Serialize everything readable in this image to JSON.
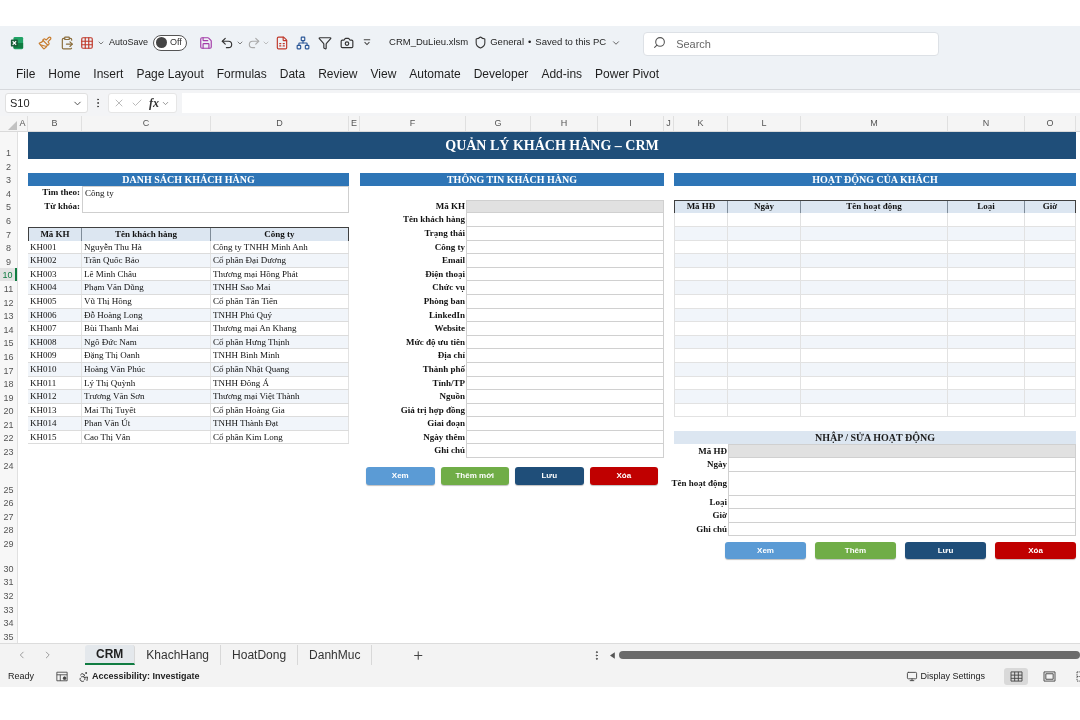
{
  "title_bar": {
    "autosave": {
      "label": "AutoSave",
      "toggle": "Off",
      "on": false
    },
    "file_name": "CRM_DuLieu.xlsm",
    "sensitivity": "General",
    "separator": "•",
    "save_status": "Saved to this PC",
    "search": {
      "placeholder": "Search"
    }
  },
  "ribbon_tabs": [
    {
      "label": "File",
      "selected": false
    },
    {
      "label": "Home",
      "selected": false
    },
    {
      "label": "Insert",
      "selected": false
    },
    {
      "label": "Page Layout",
      "selected": false
    },
    {
      "label": "Formulas",
      "selected": false
    },
    {
      "label": "Data",
      "selected": false
    },
    {
      "label": "Review",
      "selected": false
    },
    {
      "label": "View",
      "selected": false
    },
    {
      "label": "Automate",
      "selected": false
    },
    {
      "label": "Developer",
      "selected": false
    },
    {
      "label": "Add-ins",
      "selected": false
    },
    {
      "label": "Power Pivot",
      "selected": false
    }
  ],
  "formula_bar": {
    "name_box": "S10",
    "function_label": "fx"
  },
  "column_headers": [
    {
      "label": "A",
      "selected": false
    },
    {
      "label": "B",
      "selected": false
    },
    {
      "label": "C",
      "selected": false
    },
    {
      "label": "D",
      "selected": false
    },
    {
      "label": "E",
      "selected": false
    },
    {
      "label": "F",
      "selected": false
    },
    {
      "label": "G",
      "selected": false
    },
    {
      "label": "H",
      "selected": false
    },
    {
      "label": "I",
      "selected": false
    },
    {
      "label": "J",
      "selected": false
    },
    {
      "label": "K",
      "selected": false
    },
    {
      "label": "L",
      "selected": false
    },
    {
      "label": "M",
      "selected": false
    },
    {
      "label": "N",
      "selected": false
    },
    {
      "label": "O",
      "selected": false
    }
  ],
  "row_headers": [
    {
      "label": "1",
      "selected": false
    },
    {
      "label": "2",
      "selected": false
    },
    {
      "label": "3",
      "selected": false
    },
    {
      "label": "4",
      "selected": false
    },
    {
      "label": "5",
      "selected": false
    },
    {
      "label": "6",
      "selected": false
    },
    {
      "label": "7",
      "selected": false
    },
    {
      "label": "8",
      "selected": false
    },
    {
      "label": "9",
      "selected": false
    },
    {
      "label": "10",
      "selected": true
    },
    {
      "label": "11",
      "selected": false
    },
    {
      "label": "12",
      "selected": false
    },
    {
      "label": "13",
      "selected": false
    },
    {
      "label": "14",
      "selected": false
    },
    {
      "label": "15",
      "selected": false
    },
    {
      "label": "16",
      "selected": false
    },
    {
      "label": "17",
      "selected": false
    },
    {
      "label": "18",
      "selected": false
    },
    {
      "label": "19",
      "selected": false
    },
    {
      "label": "20",
      "selected": false
    },
    {
      "label": "21",
      "selected": false
    },
    {
      "label": "22",
      "selected": false
    },
    {
      "label": "23",
      "selected": false
    },
    {
      "label": "24",
      "selected": false
    },
    {
      "label": "25",
      "selected": false
    },
    {
      "label": "26",
      "selected": false
    },
    {
      "label": "27",
      "selected": false
    },
    {
      "label": "28",
      "selected": false
    },
    {
      "label": "29",
      "selected": false
    },
    {
      "label": "30",
      "selected": false
    },
    {
      "label": "31",
      "selected": false
    },
    {
      "label": "32",
      "selected": false
    },
    {
      "label": "33",
      "selected": false
    },
    {
      "label": "34",
      "selected": false
    },
    {
      "label": "35",
      "selected": false
    }
  ],
  "sheet": {
    "banner": "QUẢN LÝ KHÁCH HÀNG – CRM",
    "customer_list": {
      "title": "DANH SÁCH KHÁCH HÀNG",
      "filters": [
        {
          "label": "Tìm theo:",
          "value": "Công ty"
        },
        {
          "label": "Từ khóa:"
        }
      ],
      "table": {
        "columns": [
          "Mã KH",
          "Tên khách hàng",
          "Công ty"
        ],
        "rows": [
          [
            "KH001",
            "Nguyễn Thu Hà",
            "Công ty TNHH Minh Anh"
          ],
          [
            "KH002",
            "Trần Quốc Bảo",
            "Cổ phần Đại Dương"
          ],
          [
            "KH003",
            "Lê Minh Châu",
            "Thương mại Hồng Phát"
          ],
          [
            "KH004",
            "Phạm Văn Dũng",
            "TNHH Sao Mai"
          ],
          [
            "KH005",
            "Vũ Thị Hồng",
            "Cổ phần Tân Tiến"
          ],
          [
            "KH006",
            "Đỗ Hoàng Long",
            "TNHH Phú Quý"
          ],
          [
            "KH007",
            "Bùi Thanh Mai",
            "Thương mại An Khang"
          ],
          [
            "KH008",
            "Ngô Đức Nam",
            "Cổ phần Hưng Thịnh"
          ],
          [
            "KH009",
            "Đặng Thị Oanh",
            "TNHH Bình Minh"
          ],
          [
            "KH010",
            "Hoàng Văn Phúc",
            "Cổ phần Nhật Quang"
          ],
          [
            "KH011",
            "Lý Thị Quỳnh",
            "TNHH Đông Á"
          ],
          [
            "KH012",
            "Trương Văn Sơn",
            "Thương mại Việt Thành"
          ],
          [
            "KH013",
            "Mai Thị Tuyết",
            "Cổ phần Hoàng Gia"
          ],
          [
            "KH014",
            "Phan Văn Út",
            "TNHH Thành Đạt"
          ],
          [
            "KH015",
            "Cao Thị Vân",
            "Cổ phần Kim Long"
          ]
        ]
      }
    },
    "customer_info": {
      "title": "THÔNG TIN KHÁCH HÀNG",
      "fields": [
        {
          "label": "Mã KH",
          "readonly": true
        },
        {
          "label": "Tên khách hàng",
          "readonly": false
        },
        {
          "label": "Trạng thái",
          "readonly": false
        },
        {
          "label": "Công ty",
          "readonly": false
        },
        {
          "label": "Email",
          "readonly": false
        },
        {
          "label": "Điện thoại",
          "readonly": false
        },
        {
          "label": "Chức vụ",
          "readonly": false
        },
        {
          "label": "Phòng ban",
          "readonly": false
        },
        {
          "label": "LinkedIn",
          "readonly": false
        },
        {
          "label": "Website",
          "readonly": false
        },
        {
          "label": "Mức độ ưu tiên",
          "readonly": false
        },
        {
          "label": "Địa chỉ",
          "readonly": false
        },
        {
          "label": "Thành phố",
          "readonly": false
        },
        {
          "label": "Tỉnh/TP",
          "readonly": false
        },
        {
          "label": "Nguồn",
          "readonly": false
        },
        {
          "label": "Giá trị hợp đồng",
          "readonly": false
        },
        {
          "label": "Giai đoạn",
          "readonly": false
        },
        {
          "label": "Ngày thêm",
          "readonly": false
        },
        {
          "label": "Ghi chú",
          "readonly": false
        }
      ],
      "buttons": [
        {
          "label": "Xem",
          "color": "#5b9bd5"
        },
        {
          "label": "Thêm mới",
          "color": "#70ad47"
        },
        {
          "label": "Lưu",
          "color": "#1f4e79"
        },
        {
          "label": "Xóa",
          "color": "#c00000"
        }
      ]
    },
    "activities": {
      "title": "HOẠT ĐỘNG CỦA KHÁCH",
      "table": {
        "columns": [
          "Mã HĐ",
          "Ngày",
          "Tên hoạt động",
          "Loại",
          "Giờ"
        ]
      }
    },
    "activity_form": {
      "title": "NHẬP / SỬA HOẠT ĐỘNG",
      "fields": [
        {
          "label": "Mã HĐ",
          "readonly": true,
          "kind": "single"
        },
        {
          "label": "Ngày",
          "readonly": false,
          "kind": "single"
        },
        {
          "label": "Tên hoạt động",
          "readonly": false,
          "kind": "multiline"
        },
        {
          "label": "Loại",
          "readonly": false,
          "kind": "single"
        },
        {
          "label": "Giờ",
          "readonly": false,
          "kind": "single"
        },
        {
          "label": "Ghi chú",
          "readonly": false,
          "kind": "single"
        }
      ],
      "buttons": [
        {
          "label": "Xem",
          "color": "#5b9bd5"
        },
        {
          "label": "Thêm",
          "color": "#70ad47"
        },
        {
          "label": "Lưu",
          "color": "#1f4e79"
        },
        {
          "label": "Xóa",
          "color": "#c00000"
        }
      ]
    }
  },
  "sheet_tabs": [
    {
      "label": "CRM",
      "selected": true
    },
    {
      "label": "KhachHang",
      "selected": false
    },
    {
      "label": "HoatDong",
      "selected": false
    },
    {
      "label": "DanhMuc",
      "selected": false
    }
  ],
  "status_bar": {
    "ready": "Ready",
    "accessibility": "Accessibility: Investigate",
    "display_settings": "Display Settings",
    "views": [
      {
        "kind": "normal",
        "selected": true
      },
      {
        "kind": "page_layout",
        "selected": false
      },
      {
        "kind": "page_break",
        "selected": false
      }
    ]
  }
}
